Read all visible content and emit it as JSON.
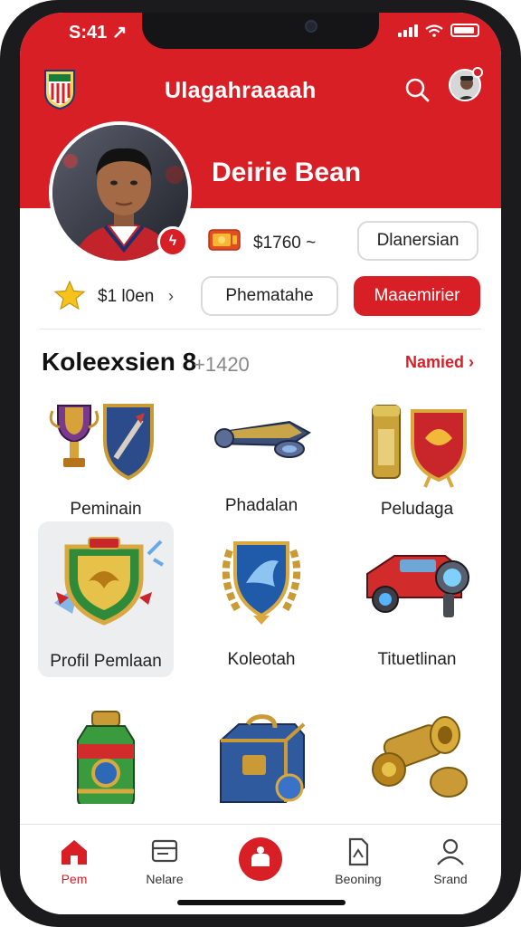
{
  "status_bar": {
    "time": "S:41 ↗"
  },
  "header": {
    "title": "Ulagahraaaah",
    "icons": [
      "club-logo",
      "search-icon",
      "avatar"
    ]
  },
  "profile": {
    "name": "Deirie Bean",
    "coins": "$1760 ~",
    "stars": "$1 l0en",
    "badge_icon": "flame-icon"
  },
  "actions": {
    "diamond_button": "Dlanersian",
    "personal_button": "Phematahe",
    "primary_button": "Maaemirier"
  },
  "collection": {
    "title": "Koleexsien 8",
    "count": "+1420",
    "see_all": "Namied",
    "items": [
      {
        "label": "Peminain",
        "icon": "trophy-shield-icon"
      },
      {
        "label": "Phadalan",
        "icon": "rocket-icon"
      },
      {
        "label": "Peludaga",
        "icon": "scroll-shield-icon"
      },
      {
        "label": "Profil Pemlaan",
        "icon": "emblem-shield-icon",
        "selected": true
      },
      {
        "label": "Koleotah",
        "icon": "laurel-shield-icon"
      },
      {
        "label": "Tituetlinan",
        "icon": "red-vehicle-icon"
      },
      {
        "label": "",
        "icon": "potion-bottle-icon"
      },
      {
        "label": "",
        "icon": "treasure-chest-icon"
      },
      {
        "label": "",
        "icon": "golden-cannon-icon"
      }
    ]
  },
  "bottom_nav": {
    "items": [
      {
        "label": "Pem",
        "icon": "home-icon",
        "active": true
      },
      {
        "label": "Nelare",
        "icon": "card-icon"
      },
      {
        "label": "",
        "icon": "center-action-icon"
      },
      {
        "label": "Beoning",
        "icon": "document-icon"
      },
      {
        "label": "Srand",
        "icon": "user-icon"
      }
    ]
  },
  "colors": {
    "accent": "#d81f26",
    "text": "#222222",
    "muted": "#888888"
  }
}
